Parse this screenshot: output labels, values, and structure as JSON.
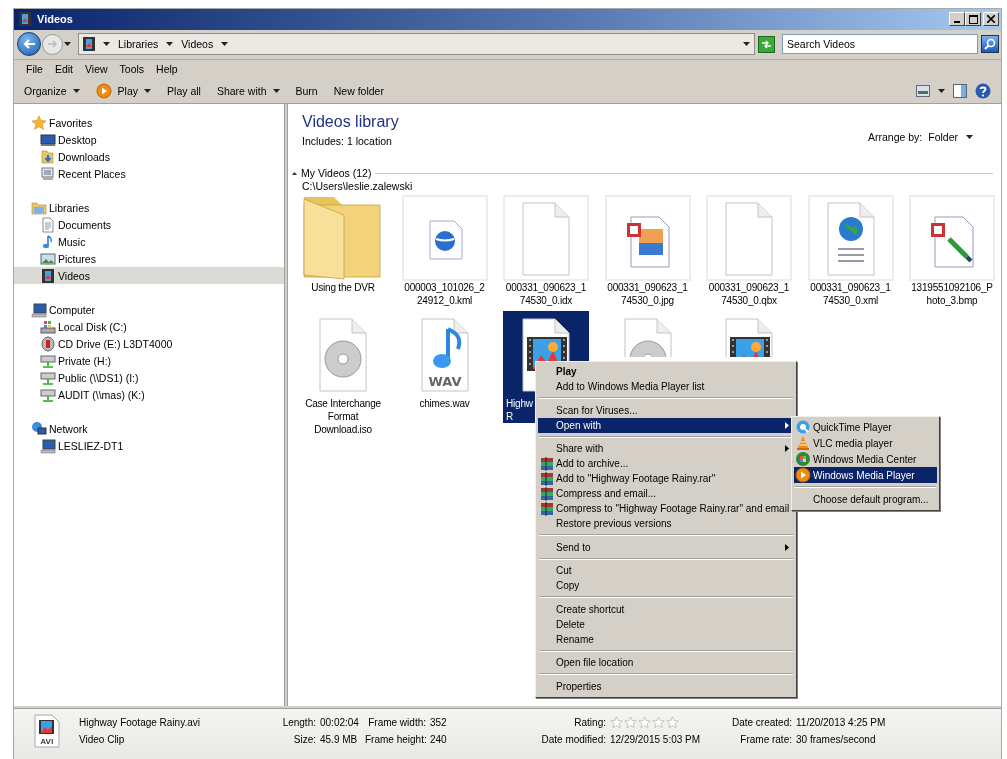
{
  "window": {
    "title": "Videos"
  },
  "address": {
    "crumbs": [
      "Libraries",
      "Videos"
    ],
    "search_placeholder": "Search Videos"
  },
  "menu_bar": [
    "File",
    "Edit",
    "View",
    "Tools",
    "Help"
  ],
  "command_bar": [
    {
      "label": "Organize",
      "kind": "plain",
      "dropdown": true
    },
    {
      "label": "Play",
      "kind": "play",
      "dropdown": true
    },
    {
      "label": "Play all",
      "kind": "plain",
      "dropdown": false
    },
    {
      "label": "Share with",
      "kind": "plain",
      "dropdown": true
    },
    {
      "label": "Burn",
      "kind": "plain",
      "dropdown": false
    },
    {
      "label": "New folder",
      "kind": "plain",
      "dropdown": false
    }
  ],
  "nav": {
    "groups": [
      {
        "label": "Favorites",
        "children": [
          {
            "label": "Desktop",
            "selected": false
          },
          {
            "label": "Downloads",
            "selected": false
          },
          {
            "label": "Recent Places",
            "selected": false
          }
        ]
      },
      {
        "label": "Libraries",
        "children": [
          {
            "label": "Documents",
            "selected": false
          },
          {
            "label": "Music",
            "selected": false
          },
          {
            "label": "Pictures",
            "selected": false
          },
          {
            "label": "Videos",
            "selected": true
          }
        ]
      },
      {
        "label": "Computer",
        "children": [
          {
            "label": "Local Disk (C:)",
            "selected": false
          },
          {
            "label": "CD Drive (E:) L3DT4000",
            "selected": false
          },
          {
            "label": "Private (H:)",
            "selected": false
          },
          {
            "label": "Public (\\\\DS1) (I:)",
            "selected": false
          },
          {
            "label": "AUDIT (\\\\mas) (K:)",
            "selected": false
          }
        ]
      },
      {
        "label": "Network",
        "children": [
          {
            "label": "LESLIEZ-DT1",
            "selected": false
          }
        ]
      }
    ]
  },
  "library": {
    "title": "Videos library",
    "includes": "Includes:  1 location",
    "arrange_label": "Arrange by:",
    "arrange_value": "Folder"
  },
  "group": {
    "header": "My Videos (12)",
    "path": "C:\\Users\\leslie.zalewski"
  },
  "files": [
    {
      "kind": "folder",
      "lines": [
        "Using the DVR"
      ],
      "selected": false
    },
    {
      "kind": "kml",
      "lines": [
        "000003_101026_2",
        "24912_0.kml"
      ],
      "selected": false
    },
    {
      "kind": "blank",
      "lines": [
        "000331_090623_1",
        "74530_0.idx"
      ],
      "selected": false
    },
    {
      "kind": "image",
      "lines": [
        "000331_090623_1",
        "74530_0.jpg"
      ],
      "selected": false
    },
    {
      "kind": "blank",
      "lines": [
        "000331_090623_1",
        "74530_0.qbx"
      ],
      "selected": false
    },
    {
      "kind": "xml",
      "lines": [
        "000331_090623_1",
        "74530_0.xml"
      ],
      "selected": false
    },
    {
      "kind": "bmp",
      "lines": [
        "1319551092106_P",
        "hoto_3.bmp"
      ],
      "selected": false
    },
    {
      "kind": "iso",
      "lines": [
        "Case Interchange",
        "Format",
        "Download.iso"
      ],
      "selected": false
    },
    {
      "kind": "wav",
      "icon_text": "WAV",
      "lines": [
        "chimes.wav"
      ],
      "selected": false
    },
    {
      "kind": "video",
      "lines": [
        "Highw",
        "R"
      ],
      "selected": true
    },
    {
      "kind": "iso",
      "selected": false
    },
    {
      "kind": "video",
      "selected": false
    }
  ],
  "context_menu": [
    {
      "kind": "item",
      "label": "Play",
      "default": true,
      "selected": false,
      "submenu": false
    },
    {
      "kind": "item",
      "label": "Add to Windows Media Player list",
      "default": false,
      "selected": false,
      "submenu": false
    },
    {
      "kind": "separator"
    },
    {
      "kind": "item",
      "label": "Scan for Viruses...",
      "default": false,
      "selected": false,
      "submenu": false
    },
    {
      "kind": "item",
      "label": "Open with",
      "default": false,
      "selected": true,
      "submenu": true
    },
    {
      "kind": "separator"
    },
    {
      "kind": "item",
      "label": "Share with",
      "default": false,
      "selected": false,
      "submenu": true
    },
    {
      "kind": "archive",
      "label": "Add to archive...",
      "default": false,
      "selected": false,
      "submenu": false
    },
    {
      "kind": "archive",
      "label": "Add to \"Highway Footage Rainy.rar\"",
      "default": false,
      "selected": false,
      "submenu": false
    },
    {
      "kind": "archive",
      "label": "Compress and email...",
      "default": false,
      "selected": false,
      "submenu": false
    },
    {
      "kind": "archive",
      "label": "Compress to \"Highway Footage Rainy.rar\" and email",
      "default": false,
      "selected": false,
      "submenu": false
    },
    {
      "kind": "item",
      "label": "Restore previous versions",
      "default": false,
      "selected": false,
      "submenu": false
    },
    {
      "kind": "separator"
    },
    {
      "kind": "item",
      "label": "Send to",
      "default": false,
      "selected": false,
      "submenu": true
    },
    {
      "kind": "separator"
    },
    {
      "kind": "item",
      "label": "Cut",
      "default": false,
      "selected": false,
      "submenu": false
    },
    {
      "kind": "item",
      "label": "Copy",
      "default": false,
      "selected": false,
      "submenu": false
    },
    {
      "kind": "separator"
    },
    {
      "kind": "item",
      "label": "Create shortcut",
      "default": false,
      "selected": false,
      "submenu": false
    },
    {
      "kind": "item",
      "label": "Delete",
      "default": false,
      "selected": false,
      "submenu": false
    },
    {
      "kind": "item",
      "label": "Rename",
      "default": false,
      "selected": false,
      "submenu": false
    },
    {
      "kind": "separator"
    },
    {
      "kind": "item",
      "label": "Open file location",
      "default": false,
      "selected": false,
      "submenu": false
    },
    {
      "kind": "separator"
    },
    {
      "kind": "item",
      "label": "Properties",
      "default": false,
      "selected": false,
      "submenu": false
    }
  ],
  "open_with_menu": [
    {
      "kind": "item",
      "label": "QuickTime Player",
      "selected": false
    },
    {
      "kind": "item",
      "label": "VLC media player",
      "selected": false
    },
    {
      "kind": "item",
      "label": "Windows Media Center",
      "selected": false
    },
    {
      "kind": "item",
      "label": "Windows Media Player",
      "selected": true
    },
    {
      "kind": "separator"
    },
    {
      "kind": "item",
      "label": "Choose default program...",
      "selected": false
    }
  ],
  "details": {
    "name": "Highway Footage Rainy.avi",
    "type": "Video Clip",
    "icon_text": "AVI",
    "fields": [
      {
        "kind": "text",
        "label": "Length:",
        "value": "00:02:04"
      },
      {
        "kind": "text",
        "label": "Frame width:",
        "value": "352"
      },
      {
        "kind": "stars",
        "label": "Rating:",
        "stars": 0
      },
      {
        "kind": "text",
        "label": "Date created:",
        "value": "11/20/2013 4:25 PM"
      },
      {
        "kind": "text",
        "label": "Size:",
        "value": "45.9 MB"
      },
      {
        "kind": "text",
        "label": "Frame height:",
        "value": "240"
      },
      {
        "kind": "text",
        "label": "Date modified:",
        "value": "12/29/2015 5:03 PM"
      },
      {
        "kind": "text",
        "label": "Frame rate:",
        "value": "30 frames/second"
      }
    ]
  }
}
